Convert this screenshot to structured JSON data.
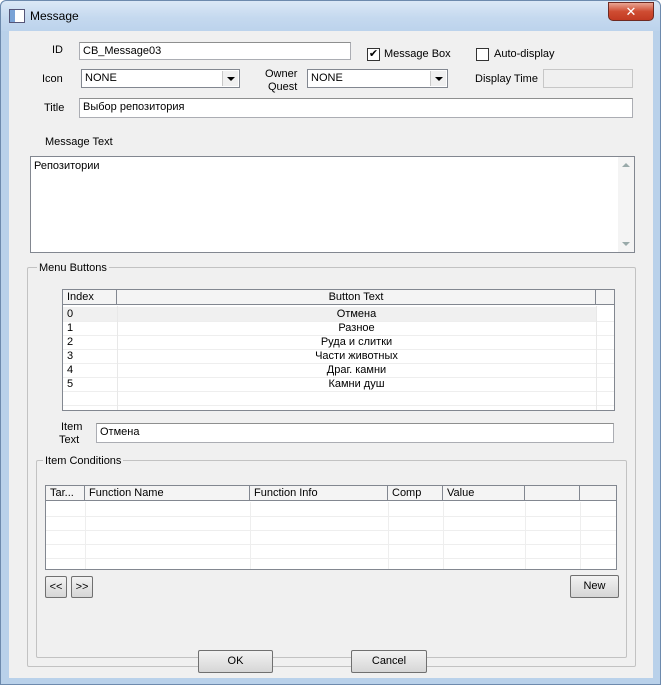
{
  "window": {
    "title": "Message",
    "close_glyph": "✕"
  },
  "fields": {
    "id_label": "ID",
    "id_value": "CB_Message03",
    "message_box_label": "Message Box",
    "message_box_checked": true,
    "auto_display_label": "Auto-display",
    "auto_display_checked": false,
    "icon_label": "Icon",
    "icon_value": "NONE",
    "owner_quest_label_1": "Owner",
    "owner_quest_label_2": "Quest",
    "owner_quest_value": "NONE",
    "display_time_label": "Display Time",
    "display_time_value": "",
    "title_label": "Title",
    "title_value": "Выбор репозитория",
    "message_text_label": "Message Text",
    "message_text_value": "Репозитории"
  },
  "menu_buttons": {
    "group_label": "Menu Buttons",
    "columns": [
      "Index",
      "Button Text"
    ],
    "rows": [
      {
        "index": "0",
        "text": "Отмена"
      },
      {
        "index": "1",
        "text": "Разное"
      },
      {
        "index": "2",
        "text": "Руда и слитки"
      },
      {
        "index": "3",
        "text": "Части животных"
      },
      {
        "index": "4",
        "text": "Драг. камни"
      },
      {
        "index": "5",
        "text": "Камни душ"
      }
    ],
    "item_text_label_1": "Item",
    "item_text_label_2": "Text",
    "item_text_value": "Отмена"
  },
  "item_conditions": {
    "group_label": "Item Conditions",
    "columns": [
      "Tar...",
      "Function Name",
      "Function Info",
      "Comp",
      "Value",
      "",
      ""
    ],
    "prev_label": "<<",
    "next_label": ">>",
    "new_label": "New"
  },
  "footer": {
    "ok_label": "OK",
    "cancel_label": "Cancel"
  },
  "colors": {
    "window_frame": "#b9d1ea",
    "dialog_bg": "#f0f0f0",
    "selected_row": "#f0f0f0"
  }
}
